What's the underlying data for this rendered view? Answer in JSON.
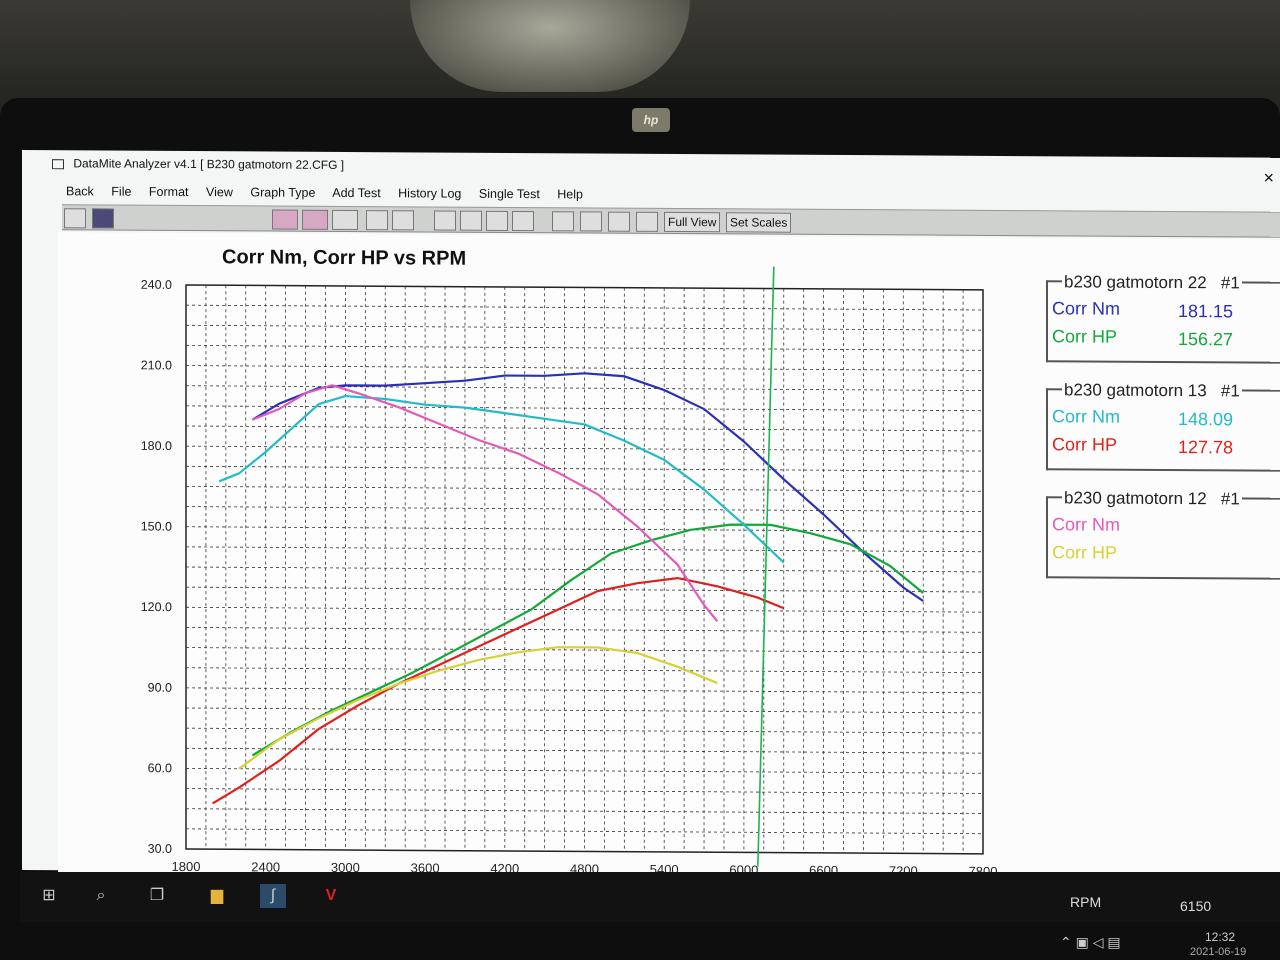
{
  "window": {
    "title": "DataMite Analyzer v4.1  [ B230 gatmotorn 22.CFG ]",
    "close": "×"
  },
  "menu": [
    "Back",
    "File",
    "Format",
    "View",
    "Graph Type",
    "Add Test",
    "History Log",
    "Single Test",
    "Help"
  ],
  "toolbar": {
    "full_view": "Full View",
    "set_scales": "Set Scales"
  },
  "status": {
    "rpm_label": "RPM",
    "rpm_value": "6150"
  },
  "taskbar": {
    "time": "12:32",
    "date": "2021-06-19"
  },
  "brand": "hp",
  "legends": [
    {
      "title": "b230 gatmotorn 22",
      "num": "#1",
      "rows": [
        {
          "label": "Corr Nm",
          "value": "181.15",
          "color": "#2a2fb8"
        },
        {
          "label": "Corr HP",
          "value": "156.27",
          "color": "#12a83a"
        }
      ]
    },
    {
      "title": "b230 gatmotorn 13",
      "num": "#1",
      "rows": [
        {
          "label": "Corr Nm",
          "value": "148.09",
          "color": "#21bcc8"
        },
        {
          "label": "Corr HP",
          "value": "127.78",
          "color": "#e0201c"
        }
      ]
    },
    {
      "title": "b230 gatmotorn 12",
      "num": "#1",
      "rows": [
        {
          "label": "Corr Nm",
          "value": "",
          "color": "#e35ab8"
        },
        {
          "label": "Corr HP",
          "value": "",
          "color": "#d8d038"
        }
      ]
    }
  ],
  "chart_data": {
    "type": "line",
    "title": "Corr Nm, Corr HP vs RPM",
    "xlabel": "",
    "ylabel": "",
    "xlim": [
      1800,
      7800
    ],
    "ylim": [
      30,
      240
    ],
    "x_ticks": [
      "1800",
      "2400",
      "3000",
      "3600",
      "4200",
      "4800",
      "5400",
      "6000",
      "6600",
      "7200",
      "7800"
    ],
    "y_ticks": [
      "30.0",
      "60.0",
      "90.0",
      "120.0",
      "150.0",
      "180.0",
      "210.0",
      "240.0"
    ],
    "grid": true,
    "cursor_rpm": 6150,
    "series": [
      {
        "name": "Corr Nm",
        "color": "#2a2fb8",
        "points": [
          [
            2300,
            190
          ],
          [
            2500,
            196
          ],
          [
            2800,
            202
          ],
          [
            3000,
            203
          ],
          [
            3300,
            203
          ],
          [
            3600,
            204
          ],
          [
            3900,
            205
          ],
          [
            4200,
            207
          ],
          [
            4500,
            207
          ],
          [
            4800,
            208
          ],
          [
            5100,
            207
          ],
          [
            5400,
            202
          ],
          [
            5700,
            195
          ],
          [
            6000,
            183
          ],
          [
            6300,
            169
          ],
          [
            6600,
            156
          ],
          [
            6900,
            142
          ],
          [
            7200,
            129
          ],
          [
            7350,
            124
          ]
        ]
      },
      {
        "name": "Corr HP",
        "color": "#12a83a",
        "points": [
          [
            2300,
            65
          ],
          [
            2600,
            74
          ],
          [
            2900,
            82
          ],
          [
            3200,
            89
          ],
          [
            3500,
            96
          ],
          [
            3800,
            104
          ],
          [
            4100,
            112
          ],
          [
            4400,
            120
          ],
          [
            4700,
            131
          ],
          [
            5000,
            141
          ],
          [
            5300,
            146
          ],
          [
            5600,
            150
          ],
          [
            5900,
            152
          ],
          [
            6200,
            152
          ],
          [
            6500,
            149
          ],
          [
            6800,
            145
          ],
          [
            7100,
            137
          ],
          [
            7350,
            127
          ]
        ]
      },
      {
        "name": "Corr Nm",
        "color": "#21bcc8",
        "points": [
          [
            2050,
            167
          ],
          [
            2200,
            170
          ],
          [
            2400,
            178
          ],
          [
            2600,
            187
          ],
          [
            2800,
            196
          ],
          [
            3000,
            199
          ],
          [
            3300,
            198
          ],
          [
            3600,
            196
          ],
          [
            3900,
            195
          ],
          [
            4200,
            193
          ],
          [
            4500,
            191
          ],
          [
            4800,
            189
          ],
          [
            5100,
            183
          ],
          [
            5400,
            176
          ],
          [
            5700,
            165
          ],
          [
            6000,
            152
          ],
          [
            6300,
            138
          ]
        ]
      },
      {
        "name": "Corr HP",
        "color": "#e0201c",
        "points": [
          [
            2000,
            47
          ],
          [
            2200,
            53
          ],
          [
            2500,
            63
          ],
          [
            2800,
            75
          ],
          [
            3100,
            84
          ],
          [
            3400,
            92
          ],
          [
            3700,
            99
          ],
          [
            4000,
            106
          ],
          [
            4300,
            113
          ],
          [
            4600,
            120
          ],
          [
            4900,
            127
          ],
          [
            5200,
            130
          ],
          [
            5500,
            132
          ],
          [
            5800,
            129
          ],
          [
            6100,
            125
          ],
          [
            6300,
            121
          ]
        ]
      },
      {
        "name": "Corr Nm",
        "color": "#e35ab8",
        "points": [
          [
            2300,
            190
          ],
          [
            2500,
            194
          ],
          [
            2700,
            200
          ],
          [
            2900,
            203
          ],
          [
            3100,
            200
          ],
          [
            3400,
            195
          ],
          [
            3700,
            189
          ],
          [
            4000,
            183
          ],
          [
            4300,
            178
          ],
          [
            4600,
            171
          ],
          [
            4900,
            163
          ],
          [
            5200,
            151
          ],
          [
            5500,
            137
          ],
          [
            5700,
            122
          ],
          [
            5800,
            116
          ]
        ]
      },
      {
        "name": "Corr HP",
        "color": "#d8d038",
        "points": [
          [
            2200,
            60
          ],
          [
            2500,
            71
          ],
          [
            2800,
            79
          ],
          [
            3100,
            86
          ],
          [
            3400,
            92
          ],
          [
            3700,
            97
          ],
          [
            4000,
            101
          ],
          [
            4300,
            104
          ],
          [
            4600,
            106
          ],
          [
            4900,
            106
          ],
          [
            5200,
            104
          ],
          [
            5500,
            99
          ],
          [
            5800,
            93
          ]
        ]
      }
    ]
  }
}
